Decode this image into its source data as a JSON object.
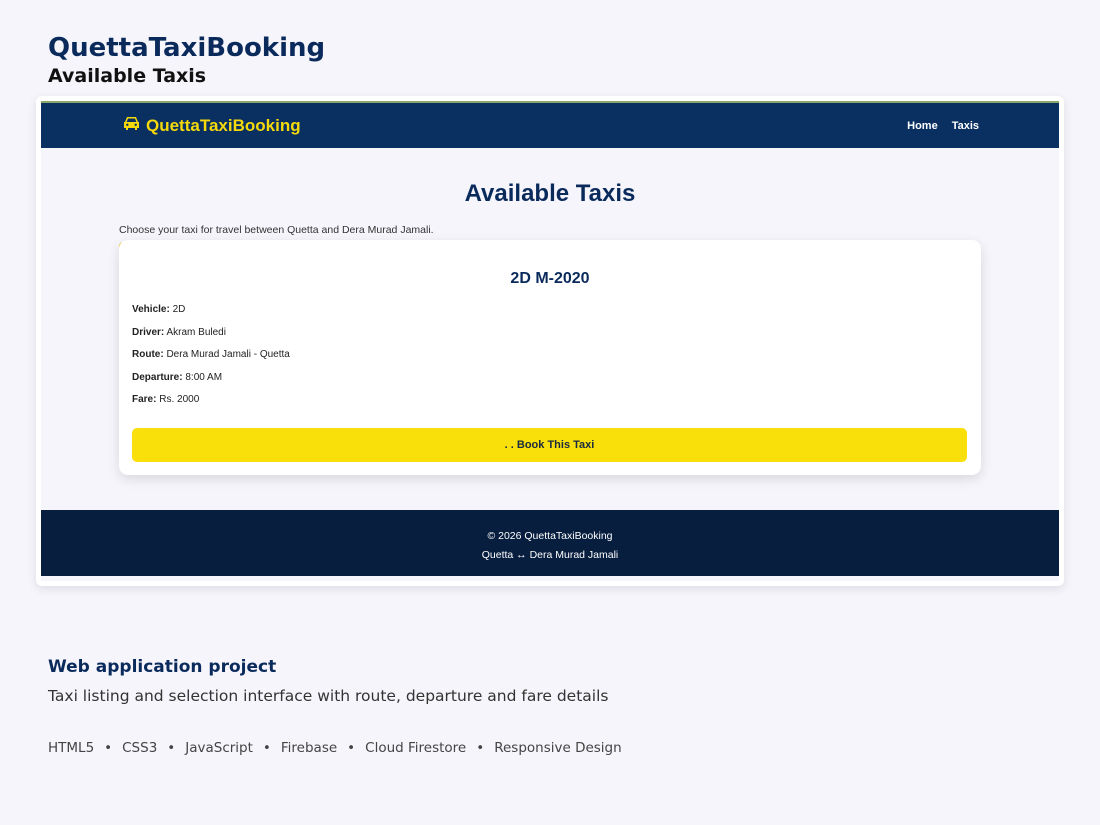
{
  "header": {
    "title": "QuettaTaxiBooking",
    "subtitle": "Available Taxis"
  },
  "site": {
    "brand": {
      "name": "QuettaTaxiBooking",
      "icon": "taxi-icon",
      "color": "#f5d90a"
    },
    "nav": [
      {
        "label": "Home"
      },
      {
        "label": "Taxis"
      }
    ],
    "page_title": "Available Taxis",
    "intro": "Choose your taxi for travel between Quetta and Dera Murad Jamali.",
    "taxi": {
      "title": "2D M-2020",
      "details": [
        {
          "label": "Vehicle:",
          "value": "2D"
        },
        {
          "label": "Driver:",
          "value": "Akram Buledi"
        },
        {
          "label": "Route:",
          "value": "Dera Murad Jamali - Quetta"
        },
        {
          "label": "Departure:",
          "value": "8:00 AM"
        },
        {
          "label": "Fare:",
          "value": "Rs. 2000"
        }
      ],
      "book_label": ". . Book This Taxi",
      "button_color": "#f9e00a"
    },
    "footer": {
      "line1": "© 2026 QuettaTaxiBooking",
      "line2": "Quetta ↔ Dera Murad Jamali"
    },
    "nav_color": "#093061"
  },
  "project": {
    "title": "Web application project",
    "description": "Taxi listing and selection interface with route, departure and fare details",
    "tech": [
      "HTML5",
      "CSS3",
      "JavaScript",
      "Firebase",
      "Cloud Firestore",
      "Responsive Design"
    ]
  }
}
